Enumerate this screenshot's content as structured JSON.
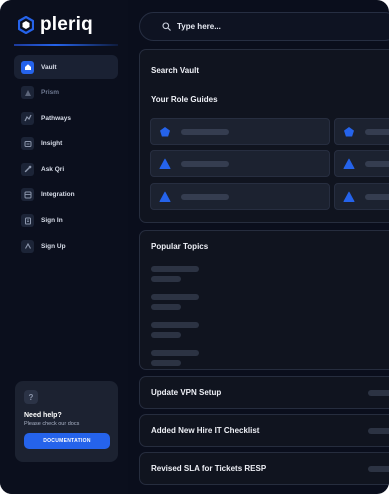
{
  "brand": {
    "name": "pleriq",
    "accent": "#2563eb"
  },
  "sidebar": {
    "items": [
      {
        "label": "Vault",
        "icon": "home-icon",
        "active": true
      },
      {
        "label": "Prism",
        "icon": "prism-icon",
        "disabled": true
      },
      {
        "label": "Pathways",
        "icon": "pathways-icon"
      },
      {
        "label": "Insight",
        "icon": "insight-icon"
      },
      {
        "label": "Ask Qri",
        "icon": "chat-icon"
      },
      {
        "label": "Integration",
        "icon": "integration-icon"
      },
      {
        "label": "Sign In",
        "icon": "sign-in-icon"
      },
      {
        "label": "Sign Up",
        "icon": "sign-up-icon"
      }
    ],
    "help": {
      "icon": "question-icon",
      "title": "Need help?",
      "subtitle": "Please check our docs",
      "button": "DOCUMENTATION"
    }
  },
  "search": {
    "placeholder": "Type here...",
    "icon": "search-icon"
  },
  "vault": {
    "title": "Search Vault",
    "guides_title": "Your Role Guides",
    "guides": [
      {
        "icon": "pentagon-icon"
      },
      {
        "icon": "pentagon-icon"
      },
      {
        "icon": "triangle-icon"
      },
      {
        "icon": "triangle-icon"
      },
      {
        "icon": "triangle-icon"
      },
      {
        "icon": "triangle-icon"
      }
    ]
  },
  "topics": {
    "title": "Popular Topics"
  },
  "updates": [
    {
      "title": "Update VPN Setup"
    },
    {
      "title": "Added New Hire IT Checklist"
    },
    {
      "title": "Revised SLA for Tickets RESP"
    }
  ]
}
